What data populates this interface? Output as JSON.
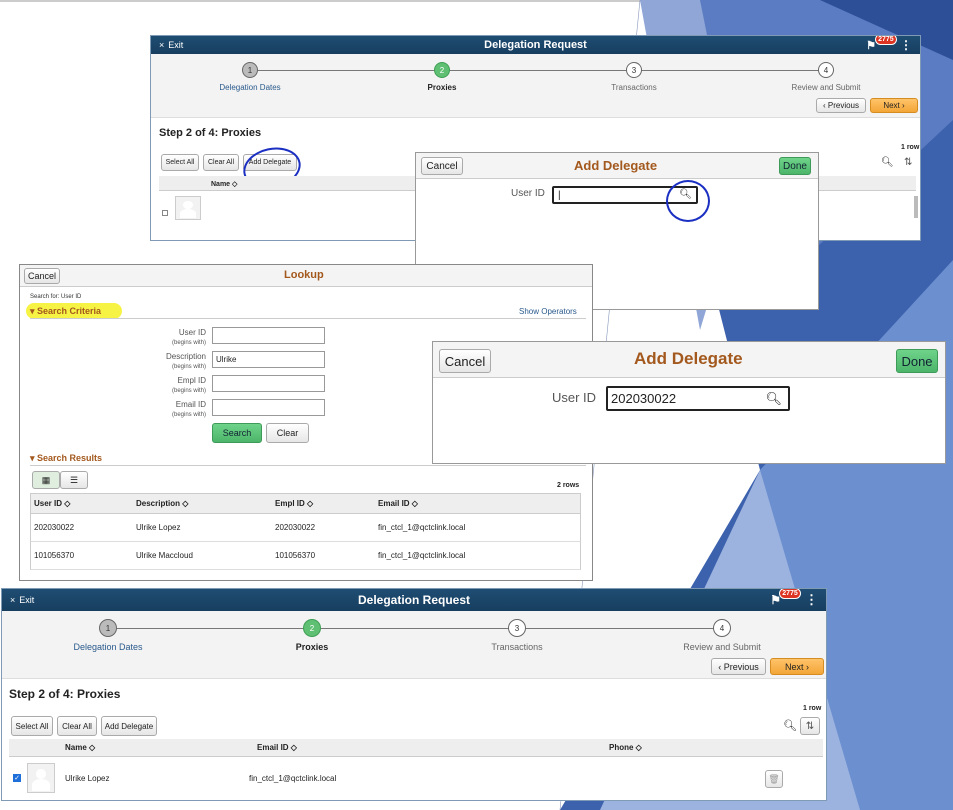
{
  "common": {
    "exit_label": "Exit",
    "window_title": "Delegation Request",
    "badge_count": "2775",
    "steps": [
      {
        "num": "1",
        "label": "Delegation Dates"
      },
      {
        "num": "2",
        "label": "Proxies"
      },
      {
        "num": "3",
        "label": "Transactions"
      },
      {
        "num": "4",
        "label": "Review and Submit"
      }
    ],
    "previous_label": "Previous",
    "next_label": "Next",
    "step_heading": "Step 2 of 4: Proxies",
    "row_count": "1 row",
    "select_all": "Select All",
    "clear_all": "Clear All",
    "add_delegate": "Add Delegate",
    "col_name": "Name",
    "col_email": "Email ID",
    "col_phone": "Phone"
  },
  "add_delegate_dialog": {
    "cancel": "Cancel",
    "title": "Add Delegate",
    "done": "Done",
    "user_id_label": "User ID",
    "user_id_value": "",
    "user_id_filled": "202030022"
  },
  "lookup": {
    "cancel": "Cancel",
    "title": "Lookup",
    "search_for": "Search for:  User ID",
    "search_criteria": "Search Criteria",
    "show_operators": "Show Operators",
    "fields": [
      {
        "label": "User ID",
        "hint": "(begins with)",
        "value": ""
      },
      {
        "label": "Description",
        "hint": "(begins with)",
        "value": "Ulrike"
      },
      {
        "label": "Empl ID",
        "hint": "(begins with)",
        "value": ""
      },
      {
        "label": "Email ID",
        "hint": "(begins with)",
        "value": ""
      }
    ],
    "search_btn": "Search",
    "clear_btn": "Clear",
    "search_results": "Search Results",
    "rows_count": "2 rows",
    "columns": [
      "User ID",
      "Description",
      "Empl ID",
      "Email ID"
    ],
    "rows": [
      [
        "202030022",
        "Ulrike Lopez",
        "202030022",
        "fin_ctcl_1@qctclink.local"
      ],
      [
        "101056370",
        "Ulrike Maccloud",
        "101056370",
        "fin_ctcl_1@qctclink.local"
      ]
    ]
  },
  "result_row": {
    "name": "Ulrike Lopez",
    "email": "fin_ctcl_1@qctclink.local"
  }
}
